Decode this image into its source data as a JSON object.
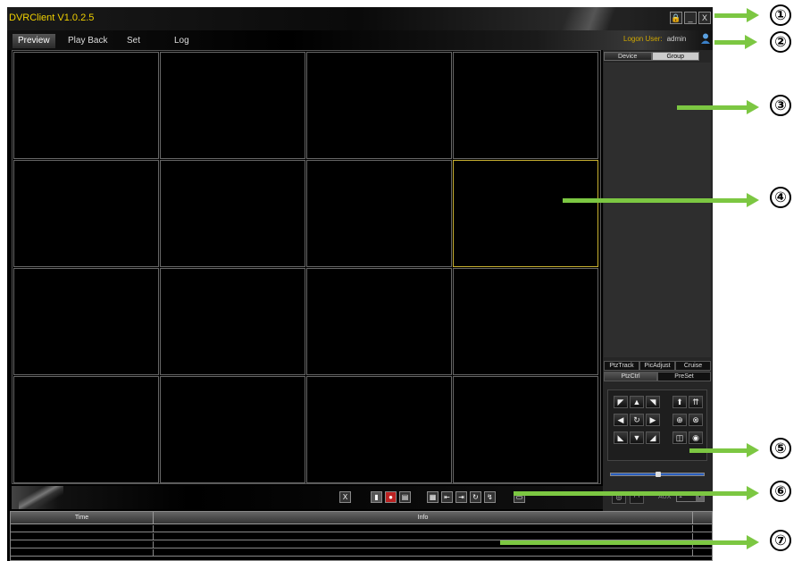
{
  "app": {
    "title": "DVRClient V1.0.2.5"
  },
  "window_controls": {
    "lock": "🔒",
    "minimize": "_",
    "close": "X"
  },
  "menu": [
    {
      "label": "Preview",
      "active": true
    },
    {
      "label": "Play Back",
      "active": false
    },
    {
      "label": "Set",
      "active": false
    },
    {
      "label": "Log",
      "active": false
    }
  ],
  "logon": {
    "label": "Logon User:",
    "user": "admin"
  },
  "device_tabs": [
    {
      "label": "Device",
      "active": true
    },
    {
      "label": "Group",
      "active": false
    }
  ],
  "video_grid": {
    "rows": 4,
    "cols": 4,
    "selected_cell": 8
  },
  "ptz_tabs_row1": [
    "PtzTrack",
    "PicAdjust",
    "Cruise"
  ],
  "ptz_tabs_row2": [
    "PtzCtrl",
    "PreSet"
  ],
  "ptz_controls": {
    "up_left": "◤",
    "up": "▲",
    "up_right": "◥",
    "left": "◀",
    "auto": "↻",
    "right": "▶",
    "down_left": "◣",
    "down": "▼",
    "down_right": "◢",
    "zoom_in": "⬆",
    "zoom_out": "⇈",
    "focus_near": "⊕",
    "focus_far": "⊗",
    "iris_open": "◫",
    "iris_close": "◉"
  },
  "aux": {
    "label": "AUX",
    "value": "1"
  },
  "toolbar": {
    "close_all": "X"
  },
  "log_table": {
    "columns": [
      "Time",
      "Info"
    ]
  },
  "annotations": [
    "①",
    "②",
    "③",
    "④",
    "⑤",
    "⑥",
    "⑦"
  ],
  "colors": {
    "title": "#f0d000",
    "logon": "#d0a800",
    "selected_border": "#c8b030",
    "annotation_arrow": "#7cc742",
    "slider": "#2a5fbf"
  }
}
